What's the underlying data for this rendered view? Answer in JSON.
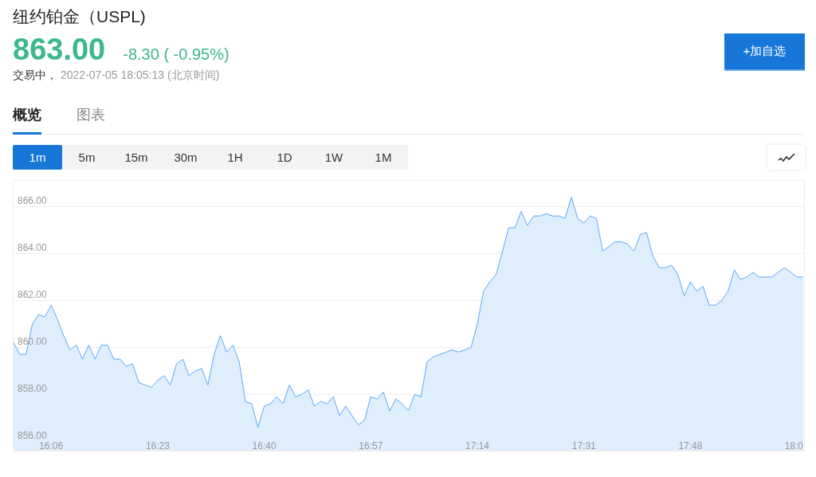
{
  "header": {
    "title": "纽约铂金（USPL)",
    "price": "863.00",
    "change": "-8.30 ( -0.95%)",
    "status": "交易中，",
    "timestamp": "2022-07-05 18:05:13",
    "timezone": "(北京时间)",
    "add_button": "+加自选"
  },
  "tabs": [
    {
      "label": "概览",
      "selected": true
    },
    {
      "label": "图表",
      "selected": false
    }
  ],
  "ranges": [
    {
      "label": "1m",
      "selected": true
    },
    {
      "label": "5m",
      "selected": false
    },
    {
      "label": "15m",
      "selected": false
    },
    {
      "label": "30m",
      "selected": false
    },
    {
      "label": "1H",
      "selected": false
    },
    {
      "label": "1D",
      "selected": false
    },
    {
      "label": "1W",
      "selected": false
    },
    {
      "label": "1M",
      "selected": false
    }
  ],
  "chart": {
    "chart_data": {
      "type": "area",
      "grid": true,
      "categories": [
        null,
        null,
        null,
        null,
        null,
        null,
        "16:06",
        null,
        null,
        null,
        null,
        null,
        null,
        null,
        null,
        null,
        null,
        null,
        null,
        null,
        null,
        null,
        null,
        "16:23",
        null,
        null,
        null,
        null,
        null,
        null,
        null,
        null,
        null,
        null,
        null,
        null,
        null,
        null,
        null,
        null,
        "16:40",
        null,
        null,
        null,
        null,
        null,
        null,
        null,
        null,
        null,
        null,
        null,
        null,
        null,
        null,
        null,
        null,
        "16:57",
        null,
        null,
        null,
        null,
        null,
        null,
        null,
        null,
        null,
        null,
        null,
        null,
        null,
        null,
        null,
        null,
        "17:14",
        null,
        null,
        null,
        null,
        null,
        null,
        null,
        null,
        null,
        null,
        null,
        null,
        null,
        null,
        null,
        null,
        "17:31",
        null,
        null,
        null,
        null,
        null,
        null,
        null,
        null,
        null,
        null,
        null,
        null,
        null,
        null,
        null,
        null,
        "17:48",
        null,
        null,
        null,
        null,
        null,
        null,
        null,
        null,
        null,
        null,
        null,
        null,
        null,
        null,
        null,
        null,
        "18:0",
        null
      ],
      "ylim": [
        855.6,
        867.1
      ],
      "yticks": [
        {
          "value": 856,
          "label": "856.00"
        },
        {
          "value": 858,
          "label": "858.00"
        },
        {
          "value": 860,
          "label": "860.00"
        },
        {
          "value": 862,
          "label": "862.00"
        },
        {
          "value": 864,
          "label": "864.00"
        },
        {
          "value": 866,
          "label": "866.00"
        }
      ],
      "series": [
        {
          "color": "#4a9ff5",
          "values": [
            860.2,
            859.7,
            859.7,
            861.0,
            861.4,
            861.3,
            861.8,
            861.2,
            860.5,
            859.9,
            860.1,
            859.5,
            860.1,
            859.5,
            860.1,
            860.1,
            859.5,
            859.5,
            859.2,
            859.3,
            858.5,
            858.4,
            858.3,
            858.6,
            858.8,
            858.4,
            859.3,
            859.5,
            858.8,
            859.0,
            859.1,
            858.4,
            859.7,
            860.5,
            859.8,
            860.1,
            859.4,
            857.7,
            857.6,
            856.6,
            857.5,
            857.6,
            857.9,
            857.6,
            858.4,
            857.9,
            858.0,
            858.2,
            857.5,
            857.7,
            857.6,
            857.9,
            857.1,
            857.5,
            857.1,
            856.7,
            856.9,
            857.9,
            857.8,
            858.1,
            857.3,
            857.8,
            857.6,
            857.3,
            858.0,
            857.9,
            859.4,
            859.6,
            859.7,
            859.8,
            859.9,
            859.8,
            859.9,
            860.0,
            861.0,
            862.4,
            862.8,
            863.1,
            864.1,
            865.1,
            865.1,
            865.8,
            865.2,
            865.6,
            865.6,
            865.7,
            865.6,
            865.6,
            865.5,
            866.4,
            865.5,
            865.3,
            865.6,
            865.5,
            864.1,
            864.3,
            864.5,
            864.5,
            864.4,
            864.1,
            864.8,
            864.9,
            863.9,
            863.4,
            863.4,
            863.5,
            863.1,
            862.2,
            862.8,
            862.4,
            862.6,
            861.8,
            861.8,
            862.0,
            862.4,
            863.3,
            862.9,
            863.0,
            863.2,
            863.0,
            863.0,
            863.0,
            863.2,
            863.4,
            863.2,
            863.0,
            863.0
          ]
        }
      ]
    }
  }
}
